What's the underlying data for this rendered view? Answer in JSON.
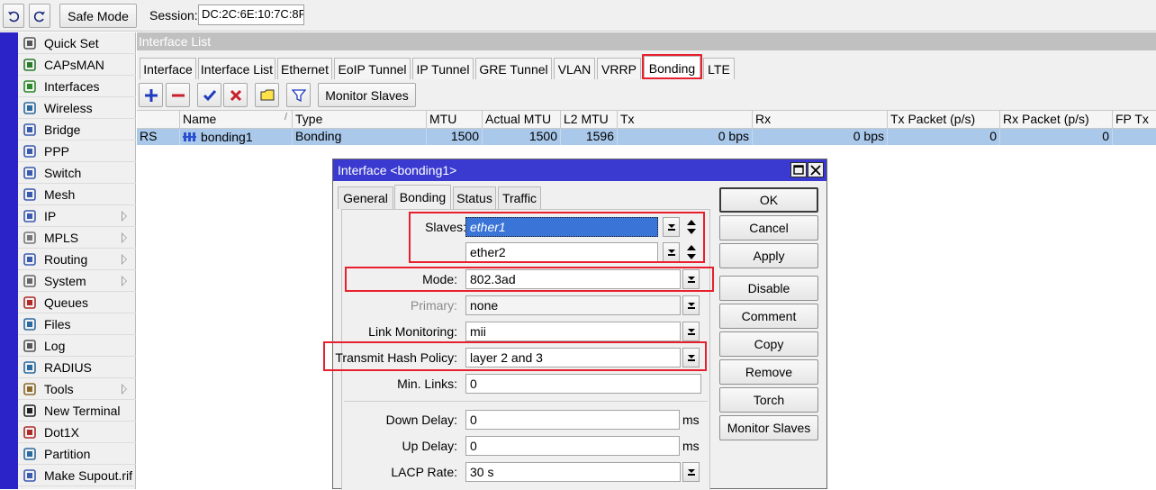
{
  "toolbar": {
    "undo_icon": "undo-icon",
    "redo_icon": "redo-icon",
    "safe_mode_label": "Safe Mode",
    "session_label": "Session:",
    "session_value": "DC:2C:6E:10:7C:8F"
  },
  "sidebar": {
    "items": [
      {
        "label": "Quick Set",
        "icon": "quick-set-icon",
        "submenu": false
      },
      {
        "label": "CAPsMAN",
        "icon": "capsman-icon",
        "submenu": false
      },
      {
        "label": "Interfaces",
        "icon": "interfaces-icon",
        "submenu": false
      },
      {
        "label": "Wireless",
        "icon": "wireless-icon",
        "submenu": false
      },
      {
        "label": "Bridge",
        "icon": "bridge-icon",
        "submenu": false
      },
      {
        "label": "PPP",
        "icon": "ppp-icon",
        "submenu": false
      },
      {
        "label": "Switch",
        "icon": "switch-icon",
        "submenu": false
      },
      {
        "label": "Mesh",
        "icon": "mesh-icon",
        "submenu": false
      },
      {
        "label": "IP",
        "icon": "ip-icon",
        "submenu": true
      },
      {
        "label": "MPLS",
        "icon": "mpls-icon",
        "submenu": true
      },
      {
        "label": "Routing",
        "icon": "routing-icon",
        "submenu": true
      },
      {
        "label": "System",
        "icon": "system-icon",
        "submenu": true
      },
      {
        "label": "Queues",
        "icon": "queues-icon",
        "submenu": false
      },
      {
        "label": "Files",
        "icon": "files-icon",
        "submenu": false
      },
      {
        "label": "Log",
        "icon": "log-icon",
        "submenu": false
      },
      {
        "label": "RADIUS",
        "icon": "radius-icon",
        "submenu": false
      },
      {
        "label": "Tools",
        "icon": "tools-icon",
        "submenu": true
      },
      {
        "label": "New Terminal",
        "icon": "terminal-icon",
        "submenu": false
      },
      {
        "label": "Dot1X",
        "icon": "dot1x-icon",
        "submenu": false
      },
      {
        "label": "Partition",
        "icon": "partition-icon",
        "submenu": false
      },
      {
        "label": "Make Supout.rif",
        "icon": "supout-icon",
        "submenu": false
      }
    ]
  },
  "interface_list": {
    "title": "Interface List",
    "tabs": [
      "Interface",
      "Interface List",
      "Ethernet",
      "EoIP Tunnel",
      "IP Tunnel",
      "GRE Tunnel",
      "VLAN",
      "VRRP",
      "Bonding",
      "LTE"
    ],
    "active_tab": "Bonding",
    "monitor_slaves_label": "Monitor Slaves",
    "columns": [
      "",
      "Name",
      "Type",
      "MTU",
      "Actual MTU",
      "L2 MTU",
      "Tx",
      "Rx",
      "Tx Packet (p/s)",
      "Rx Packet (p/s)",
      "FP Tx"
    ],
    "name_sort_indicator": "/",
    "rows": [
      {
        "flags": "RS",
        "name": "bonding1",
        "type": "Bonding",
        "mtu": "1500",
        "actual_mtu": "1500",
        "l2_mtu": "1596",
        "tx": "0 bps",
        "rx": "0 bps",
        "tx_packet": "0",
        "rx_packet": "0",
        "fp_tx": ""
      }
    ]
  },
  "dialog": {
    "title": "Interface <bonding1>",
    "tabs": [
      "General",
      "Bonding",
      "Status",
      "Traffic"
    ],
    "active_tab": "Bonding",
    "fields": {
      "slaves_label": "Slaves:",
      "slave1": "ether1",
      "slave2": "ether2",
      "mode_label": "Mode:",
      "mode_value": "802.3ad",
      "primary_label": "Primary:",
      "primary_value": "none",
      "link_monitoring_label": "Link Monitoring:",
      "link_monitoring_value": "mii",
      "hash_policy_label": "Transmit Hash Policy:",
      "hash_policy_value": "layer 2 and 3",
      "min_links_label": "Min. Links:",
      "min_links_value": "0",
      "down_delay_label": "Down Delay:",
      "down_delay_value": "0",
      "down_delay_unit": "ms",
      "up_delay_label": "Up Delay:",
      "up_delay_value": "0",
      "up_delay_unit": "ms",
      "lacp_rate_label": "LACP Rate:",
      "lacp_rate_value": "30 s"
    },
    "buttons": [
      "OK",
      "Cancel",
      "Apply",
      "Disable",
      "Comment",
      "Copy",
      "Remove",
      "Torch",
      "Monitor Slaves"
    ]
  },
  "colors": {
    "highlight_red": "#e8202e",
    "dialog_title": "#3a3ad0",
    "selected_row": "#a9c8ea",
    "sidebar_stripe": "#2b22c8"
  }
}
